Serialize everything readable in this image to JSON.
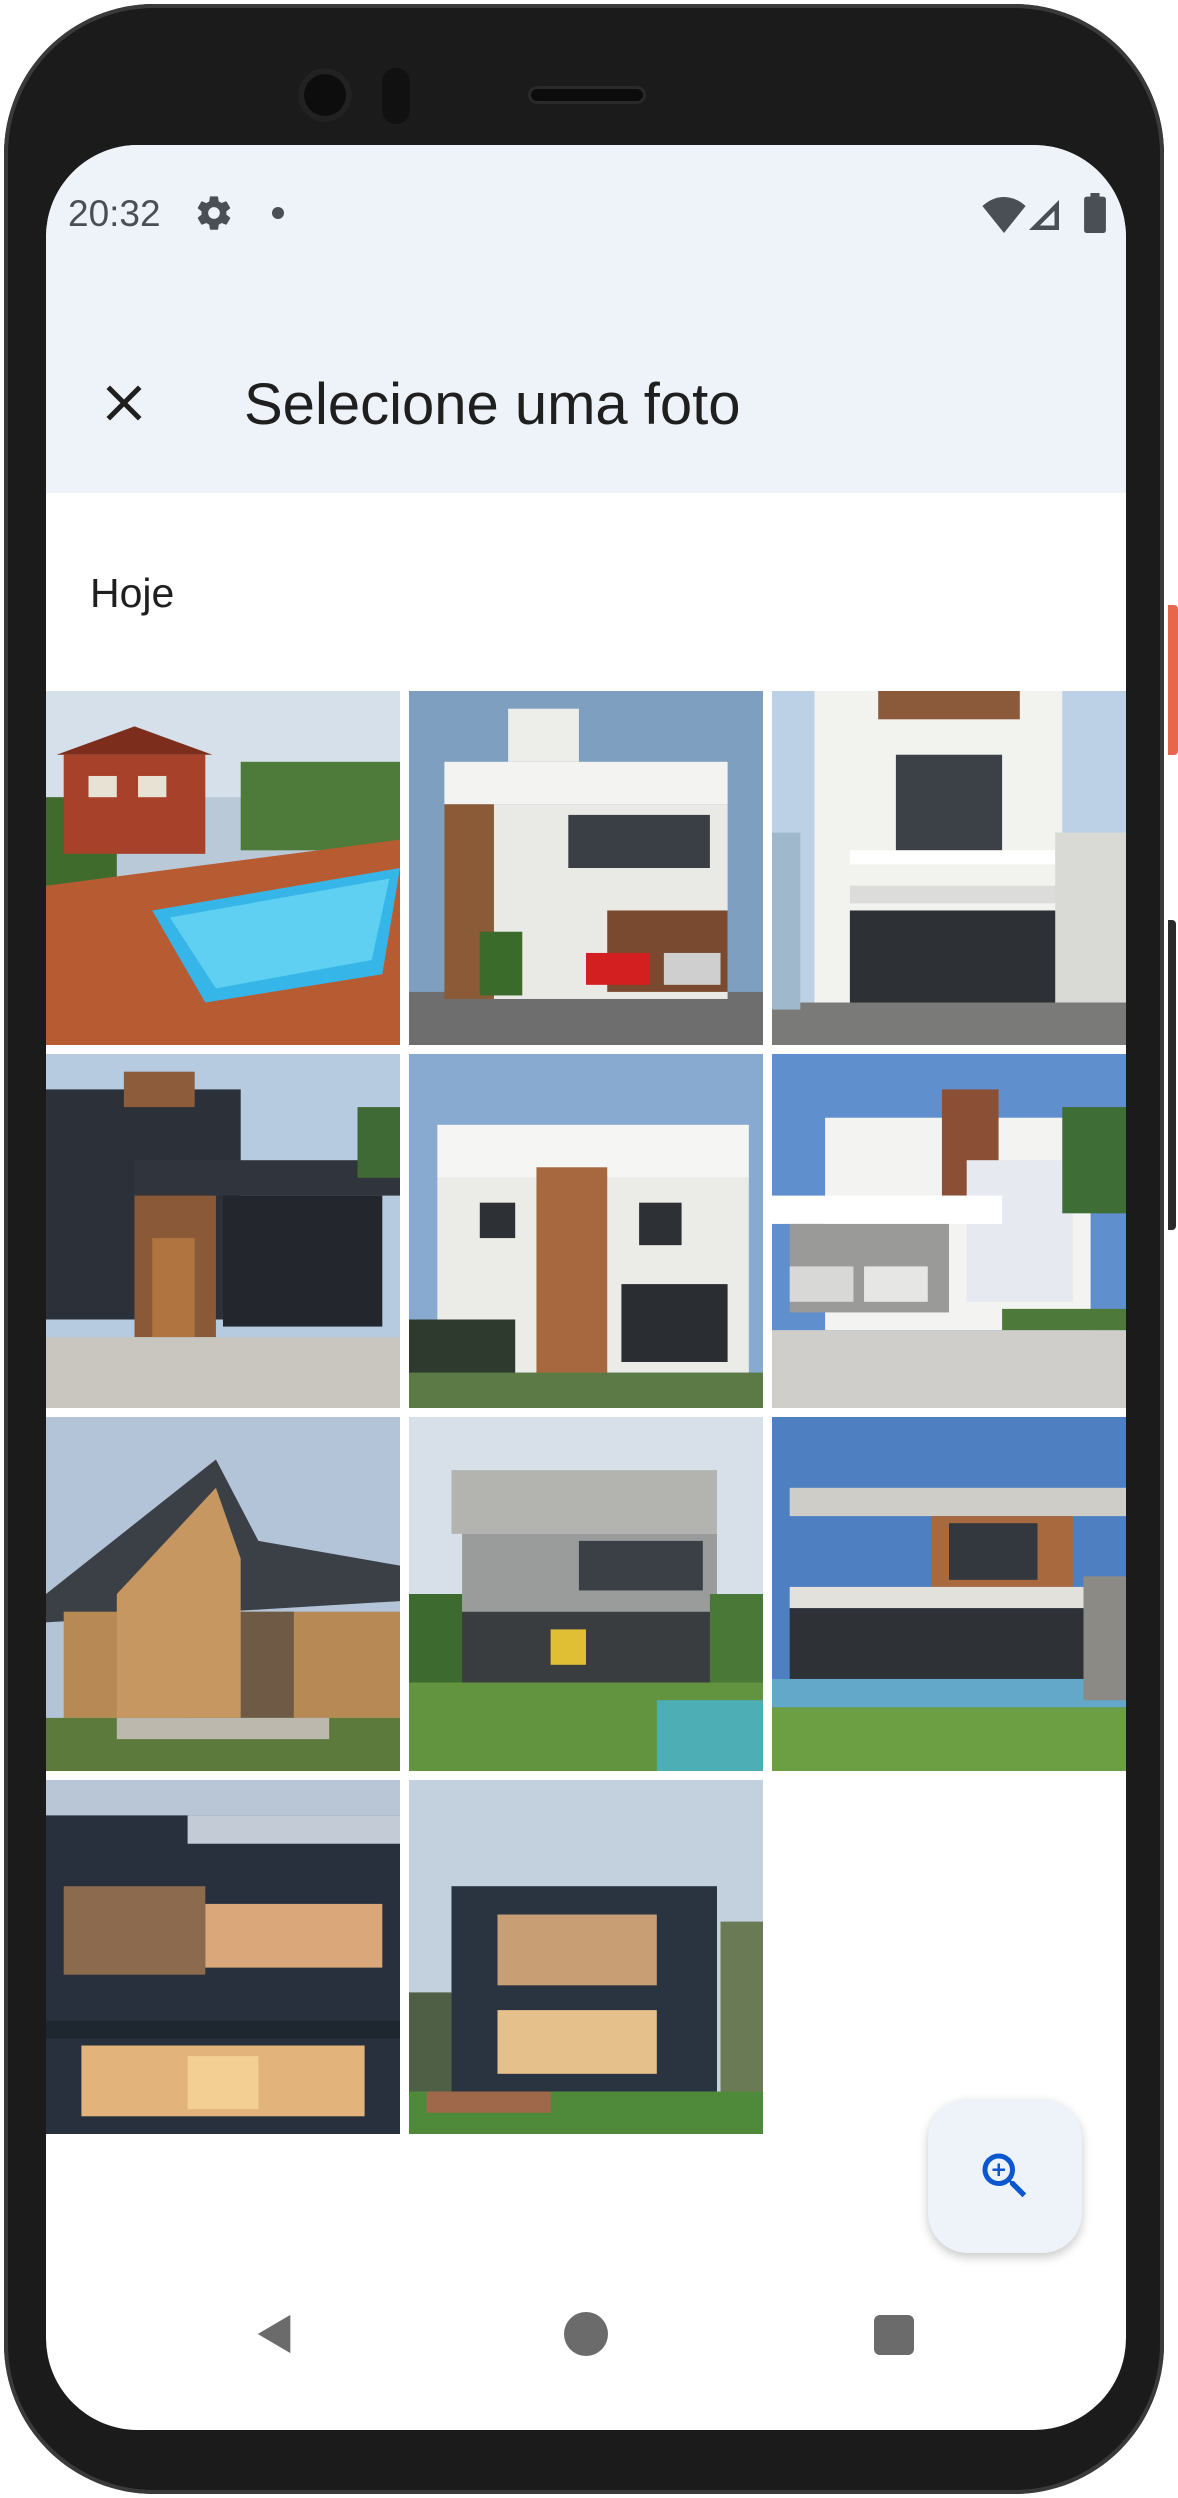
{
  "status_bar": {
    "time": "20:32",
    "icons": [
      "gear-icon",
      "notification-dot-icon",
      "wifi-icon",
      "cellular-signal-icon",
      "battery-icon"
    ]
  },
  "header": {
    "close_icon": "close-icon",
    "title": "Selecione uma foto"
  },
  "section": {
    "label": "Hoje"
  },
  "photos": [
    {
      "description": "house-with-pool"
    },
    {
      "description": "modern-house-red-car"
    },
    {
      "description": "white-two-story-house"
    },
    {
      "description": "dark-house-wood-door"
    },
    {
      "description": "white-house-wood-panel"
    },
    {
      "description": "white-house-two-cars"
    },
    {
      "description": "wooden-slanted-roof-house"
    },
    {
      "description": "concrete-house-garden"
    },
    {
      "description": "house-with-pool-lawn"
    },
    {
      "description": "dark-house-dusk"
    },
    {
      "description": "dark-house-terrace"
    }
  ],
  "fab": {
    "icon": "zoom-in-icon"
  },
  "nav_bar": {
    "icons": [
      "back-icon",
      "home-icon",
      "recents-icon"
    ]
  },
  "colors": {
    "header_bg": "#eef2f9",
    "accent": "#0b57d0",
    "text": "#1f1f1f"
  }
}
